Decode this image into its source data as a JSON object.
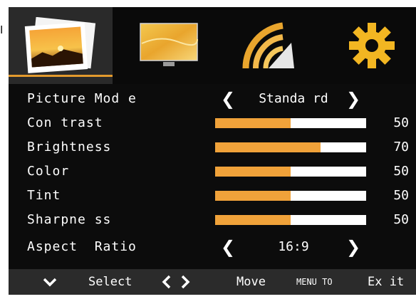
{
  "left_edge_text": "I",
  "tabs": [
    {
      "name": "picture",
      "active": true
    },
    {
      "name": "screen",
      "active": false
    },
    {
      "name": "audio",
      "active": false
    },
    {
      "name": "setup",
      "active": false
    }
  ],
  "colors": {
    "accent": "#f0a23a",
    "bg": "#0c0c0c",
    "footer_bg": "#2b2b2b"
  },
  "menu": {
    "picture_mode": {
      "label": "Picture Mod e",
      "value": "Standa rd",
      "left_icon": "chevron-left-icon",
      "right_icon": "chevron-right-icon"
    },
    "contrast": {
      "label": "Con trast",
      "value": "50",
      "level": 50
    },
    "brightness": {
      "label": "Brightness",
      "value": "70",
      "level": 70
    },
    "color": {
      "label": "Color",
      "value": "50",
      "level": 50
    },
    "tint": {
      "label": "Tint",
      "value": "50",
      "level": 50
    },
    "sharpness": {
      "label": "Sharpne ss",
      "value": "50",
      "level": 50
    },
    "aspect_ratio": {
      "label": "Aspect  Ratio",
      "value": "16:9",
      "left_icon": "chevron-left-icon",
      "right_icon": "chevron-right-icon"
    }
  },
  "footer": {
    "select_icon": "chevron-down-icon",
    "select_label": "Select",
    "move_icon": "chevron-left-right-icon",
    "move_label": "Move",
    "menu_label": "MENU TO",
    "exit_label": "Ex it"
  }
}
